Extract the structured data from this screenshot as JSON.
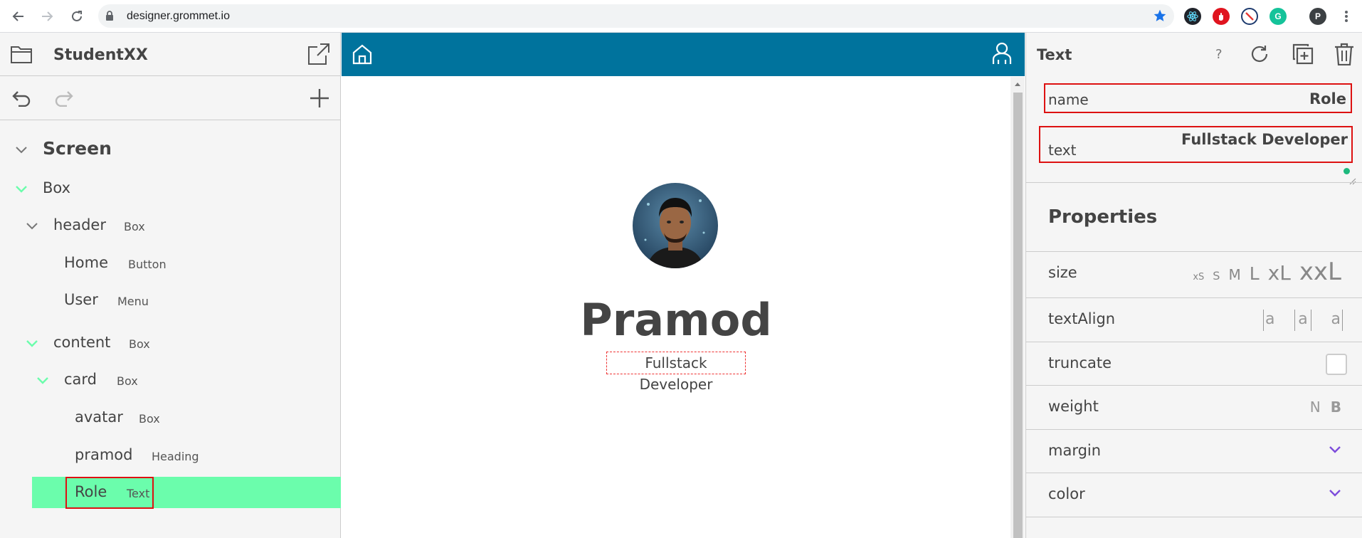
{
  "browser": {
    "url": "designer.grommet.io",
    "profile_initial": "P",
    "extensions": [
      "react-devtools-icon",
      "adblock-icon",
      "block-icon",
      "grammarly-icon"
    ]
  },
  "left": {
    "project_name": "StudentXX",
    "tree": [
      {
        "name": "Screen",
        "type": ""
      },
      {
        "name": "Box",
        "type": ""
      },
      {
        "name": "header",
        "type": "Box"
      },
      {
        "name": "Home",
        "type": "Button"
      },
      {
        "name": "User",
        "type": "Menu"
      },
      {
        "name": "content",
        "type": "Box"
      },
      {
        "name": "card",
        "type": "Box"
      },
      {
        "name": "avatar",
        "type": "Box"
      },
      {
        "name": "pramod",
        "type": "Heading"
      },
      {
        "name": "Role",
        "type": "Text"
      }
    ]
  },
  "canvas": {
    "heading": "Pramod",
    "role": "Fullstack Developer",
    "header_color": "#00739d"
  },
  "right": {
    "title": "Text",
    "help": "?",
    "name_label": "name",
    "name_value": "Role",
    "text_label": "text",
    "text_value": "Fullstack Developer",
    "properties_title": "Properties",
    "size_label": "size",
    "sizes": [
      "xS",
      "S",
      "M",
      "L",
      "xL",
      "xxL"
    ],
    "textalign_label": "textAlign",
    "align_glyph": "a",
    "truncate_label": "truncate",
    "weight_label": "weight",
    "weights": [
      "N",
      "B"
    ],
    "margin_label": "margin",
    "color_label": "color",
    "accent": "#7d4cdb",
    "selection": "#6bfdac"
  }
}
